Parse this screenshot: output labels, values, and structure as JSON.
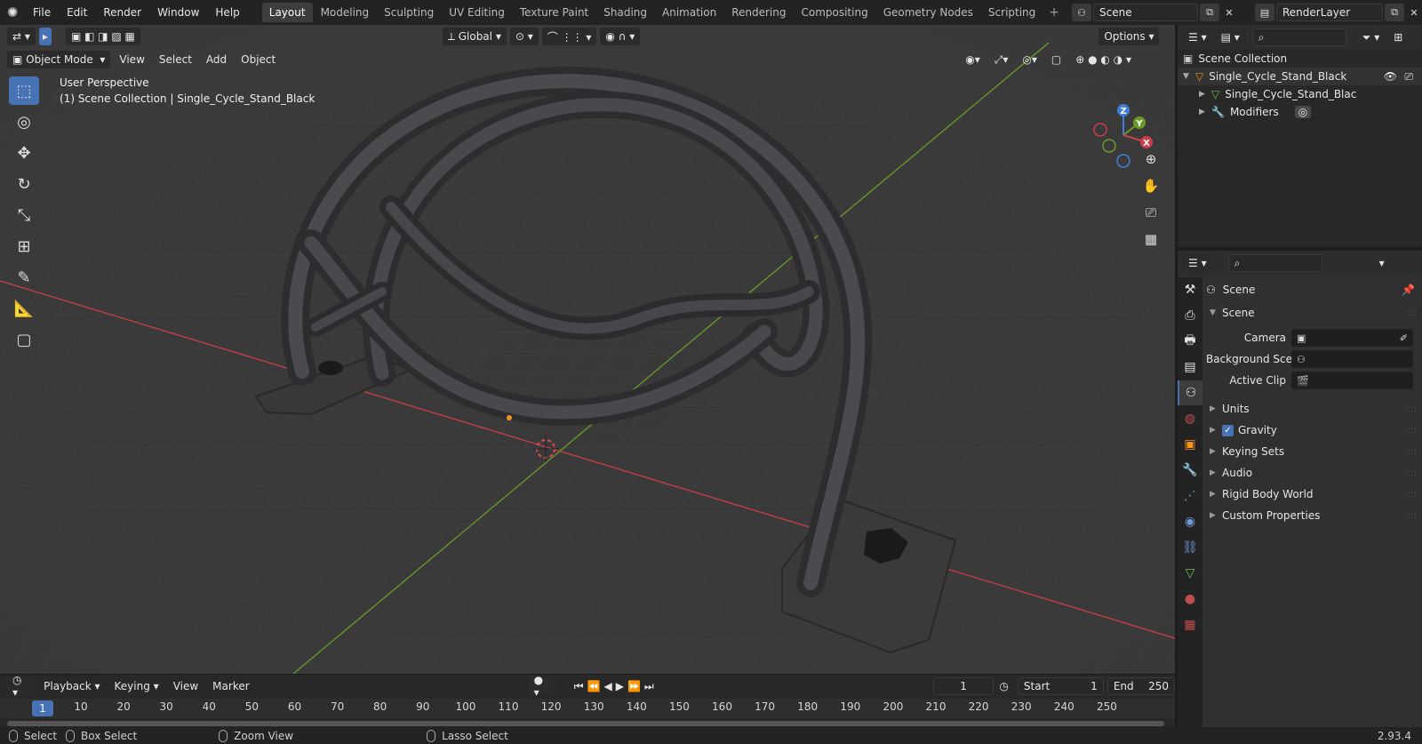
{
  "app": {
    "logo_icon": "blender-logo-icon",
    "version": "2.93.4"
  },
  "menu": [
    "File",
    "Edit",
    "Render",
    "Window",
    "Help"
  ],
  "workspace_tabs": [
    "Layout",
    "Modeling",
    "Sculpting",
    "UV Editing",
    "Texture Paint",
    "Shading",
    "Animation",
    "Rendering",
    "Compositing",
    "Geometry Nodes",
    "Scripting"
  ],
  "active_tab": "Layout",
  "scene_name": "Scene",
  "view_layer": "RenderLayer",
  "viewport": {
    "transform_orientation": "Global",
    "options_label": "Options",
    "mode": "Object Mode",
    "header_menus": [
      "View",
      "Select",
      "Add",
      "Object"
    ],
    "info_line1": "User Perspective",
    "info_line2": "(1) Scene Collection | Single_Cycle_Stand_Black",
    "gizmo_axes": {
      "x": "X",
      "y": "Y",
      "z": "Z"
    }
  },
  "timeline": {
    "menus": [
      "Playback",
      "Keying",
      "View",
      "Marker"
    ],
    "current_frame": "1",
    "start_label": "Start",
    "start_value": "1",
    "end_label": "End",
    "end_value": "250",
    "ruler_ticks": [
      "1",
      "10",
      "20",
      "30",
      "40",
      "50",
      "60",
      "70",
      "80",
      "90",
      "100",
      "110",
      "120",
      "130",
      "140",
      "150",
      "160",
      "170",
      "180",
      "190",
      "200",
      "210",
      "220",
      "230",
      "240",
      "250"
    ]
  },
  "statusbar": {
    "select": "Select",
    "box_select": "Box Select",
    "zoom_view": "Zoom View",
    "lasso_select": "Lasso Select"
  },
  "outliner": {
    "root": "Scene Collection",
    "object": "Single_Cycle_Stand_Black",
    "mesh": "Single_Cycle_Stand_Blac",
    "modifiers": "Modifiers"
  },
  "properties": {
    "context": "Scene",
    "panel_title": "Scene",
    "camera_label": "Camera",
    "background_label": "Background Sce...",
    "active_clip_label": "Active Clip",
    "sections": [
      "Units",
      "Gravity",
      "Keying Sets",
      "Audio",
      "Rigid Body World",
      "Custom Properties"
    ],
    "gravity_checked": true
  },
  "colors": {
    "accent": "#4772b3",
    "x_axis": "#cb3f4a",
    "y_axis": "#6c9a28",
    "z_axis": "#3f7ddb"
  }
}
